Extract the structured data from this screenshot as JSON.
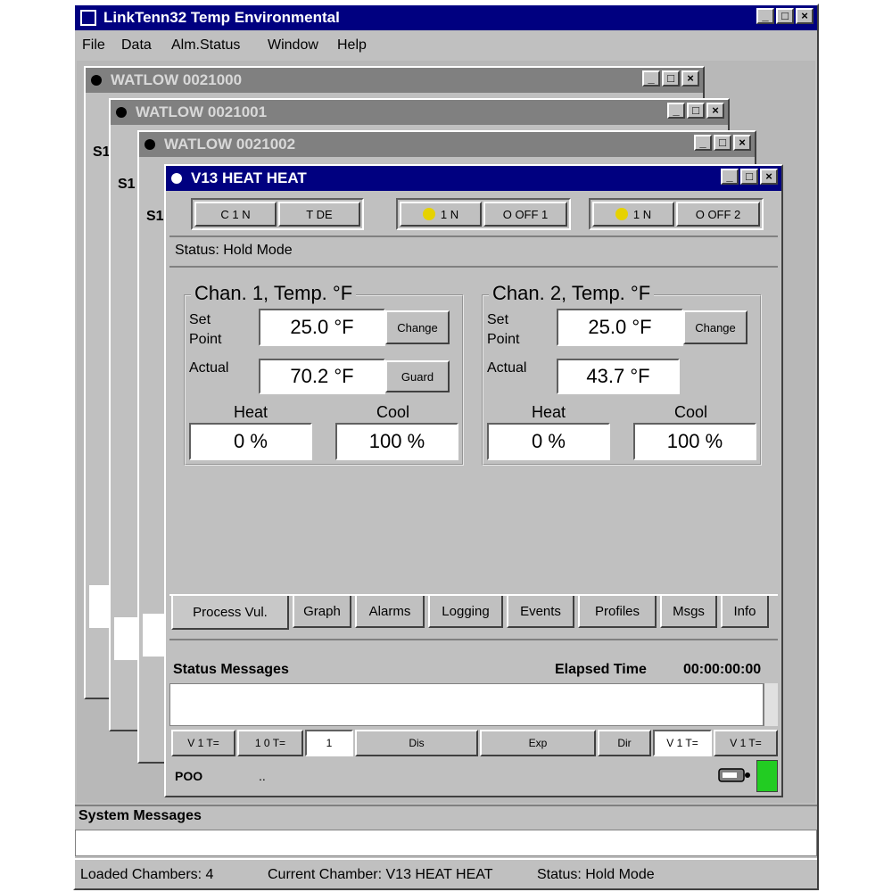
{
  "app": {
    "title": "LinkTenn32 Temp Environmental",
    "menu": [
      "File",
      "Data",
      "Alm.Status",
      "Window",
      "Help"
    ],
    "system_messages_label": "System Messages",
    "status_bar": {
      "loaded_chambers": "Loaded Chambers: 4",
      "current_chamber": "Current Chamber: V13 HEAT HEAT",
      "status": "Status: Hold Mode"
    }
  },
  "background_windows": [
    {
      "title": "WATLOW 0021000",
      "side_label": "S1"
    },
    {
      "title": "WATLOW 0021001",
      "side_label": "S1"
    },
    {
      "title": "WATLOW 0021002",
      "side_label": "S1"
    }
  ],
  "chamber": {
    "title": "V13 HEAT HEAT",
    "toolbar": [
      "C 1 N",
      "T DE",
      "1 N",
      "O OFF 1",
      "1 N",
      "O OFF 2"
    ],
    "status_text": "Status: Hold Mode",
    "channels": [
      {
        "heading": "Chan. 1, Temp. °F",
        "set_point_label": "Set Point",
        "set_point": "25.0 °F",
        "change_label": "Change",
        "actual_label": "Actual",
        "actual": "70.2 °F",
        "aux_label": "Guard",
        "heat_label": "Heat",
        "heat": "0 %",
        "cool_label": "Cool",
        "cool": "100 %"
      },
      {
        "heading": "Chan. 2, Temp. °F",
        "set_point_label": "Set Point",
        "set_point": "25.0 °F",
        "change_label": "Change",
        "actual_label": "Actual",
        "actual": "43.7 °F",
        "heat_label": "Heat",
        "heat": "0 %",
        "cool_label": "Cool",
        "cool": "100 %"
      }
    ],
    "tabs": [
      "Process Vul.",
      "Graph",
      "Alarms",
      "Logging",
      "Events",
      "Profiles",
      "Msgs",
      "Info"
    ],
    "status_messages_label": "Status Messages",
    "elapsed_label": "Elapsed Time",
    "elapsed_value": "00:00:00:00",
    "bottom_strip": [
      "V 1 T=",
      "1 0 T=",
      "1",
      "Dis",
      "Exp",
      "Dir",
      "V 1 T=",
      "V 1 T="
    ],
    "footer_left": "POO",
    "footer_mid": "..",
    "status_light_color": "#22cc22"
  },
  "colors": {
    "active_title": "#000080",
    "inactive_title": "#808080",
    "face": "#c0c0c0"
  }
}
